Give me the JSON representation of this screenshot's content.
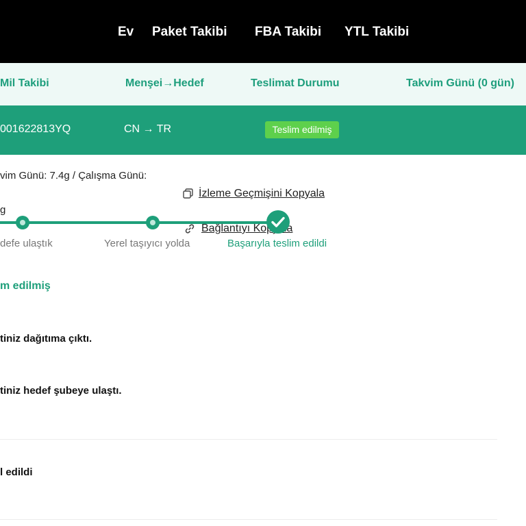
{
  "nav": {
    "items": [
      "Ev",
      "Paket Takibi",
      "FBA Takibi",
      "YTL Takibi"
    ]
  },
  "table": {
    "headers": [
      "Mil Takibi",
      "Menşei→Hedef",
      "Teslimat Durumu",
      "Takvim Günü (0 gün)"
    ],
    "row": {
      "tracking_number": "001622813YQ",
      "route": "CN → TR",
      "status": "Teslim edilmiş"
    }
  },
  "detail": {
    "days_text": "vim Günü: 7.4g / Çalışma Günü:",
    "copy_history_label": "İzleme Geçmişini Kopyala",
    "copy_link_label": "Bağlantıyı Kopyala",
    "fragment_g": "g",
    "steps": [
      "defe ulaştık",
      "Yerel taşıyıcı yolda",
      "Başarıyla teslim edildi"
    ],
    "current_status": "m edilmiş"
  },
  "events": [
    "tiniz dağıtıma çıktı.",
    "tiniz hedef şubeye ulaştı.",
    "l edildi"
  ],
  "colors": {
    "accent": "#1e9f7a",
    "badge": "#5ed04c",
    "header_bg": "#eef9f6",
    "nav_bg": "#000000"
  }
}
